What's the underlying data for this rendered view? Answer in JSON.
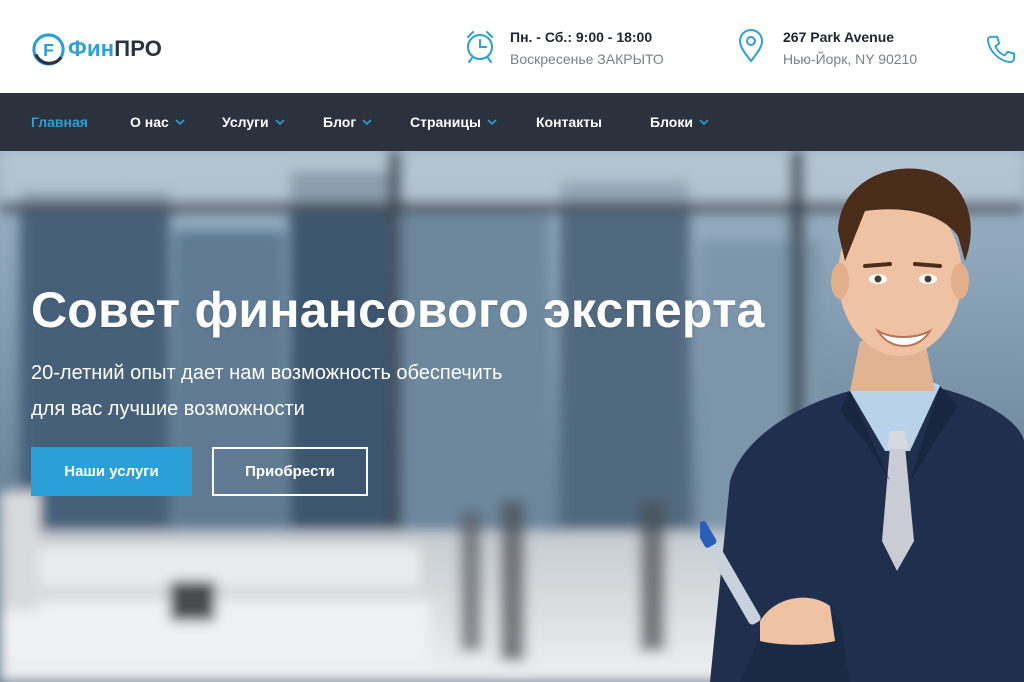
{
  "brand": {
    "logo_letter": "F",
    "name_part1": "Фин",
    "name_part2": "ПРО",
    "accent_color": "#2a9fd8",
    "dark_color": "#2b3340"
  },
  "header": {
    "hours_line1": "Пн. - Сб.: 9:00 - 18:00",
    "hours_line2": "Воскресенье ЗАКРЫТО",
    "address_line1": "267 Park Avenue",
    "address_line2": "Нью-Йорк, NY 90210",
    "icons": [
      "alarm-clock-icon",
      "map-pin-icon",
      "phone-icon"
    ]
  },
  "nav": {
    "items": [
      {
        "label": "Главная",
        "active": true,
        "has_dropdown": false
      },
      {
        "label": "О нас",
        "active": false,
        "has_dropdown": true
      },
      {
        "label": "Услуги",
        "active": false,
        "has_dropdown": true
      },
      {
        "label": "Блог",
        "active": false,
        "has_dropdown": true
      },
      {
        "label": "Страницы",
        "active": false,
        "has_dropdown": true
      },
      {
        "label": "Контакты",
        "active": false,
        "has_dropdown": false
      },
      {
        "label": "Блоки",
        "active": false,
        "has_dropdown": true
      }
    ],
    "background": "#2c323d"
  },
  "hero": {
    "title": "Совет финансового эксперта",
    "subtitle_line1": "20-летний опыт дает нам возможность обеспечить",
    "subtitle_line2": "для вас лучшие возможности",
    "primary_button": "Наши услуги",
    "secondary_button": "Приобрести"
  }
}
